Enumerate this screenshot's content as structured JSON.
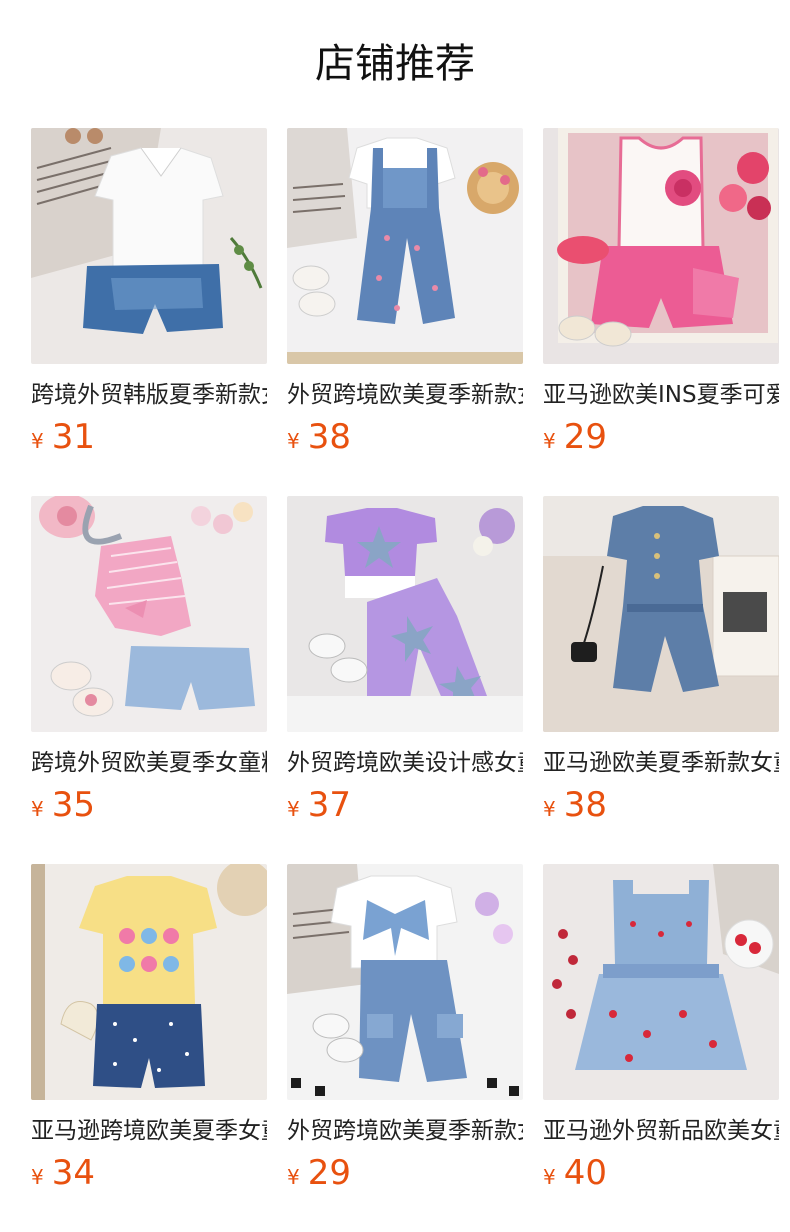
{
  "page": {
    "title": "店铺推荐"
  },
  "theme": {
    "price_color": "#e8510f",
    "text_color": "#222222"
  },
  "products": [
    {
      "name": "跨境外贸韩版夏季新款女童白色翻领短袖牛仔短裤套装",
      "currency": "¥",
      "price": "31",
      "image": "white-collar-top-denim-shorts"
    },
    {
      "name": "外贸跨境欧美夏季新款女童白色T恤牛仔背带裤套装",
      "currency": "¥",
      "price": "38",
      "image": "white-tee-denim-overalls"
    },
    {
      "name": "亚马逊欧美INS夏季可爱女童玫瑰背心粉色短裤套装",
      "currency": "¥",
      "price": "29",
      "image": "rose-tank-pink-shorts"
    },
    {
      "name": "跨境外贸欧美夏季女童粉色条纹斜肩上衣牛仔短裤套装",
      "currency": "¥",
      "price": "35",
      "image": "pink-striped-top-denim-shorts"
    },
    {
      "name": "外贸跨境欧美设计感女童星星紫色短袖长裤套装",
      "currency": "¥",
      "price": "37",
      "image": "purple-star-tee-pants"
    },
    {
      "name": "亚马逊欧美夏季新款女童牛仔短袖连体短裤",
      "currency": "¥",
      "price": "38",
      "image": "denim-romper"
    },
    {
      "name": "亚马逊跨境欧美夏季女童黄色花朵T恤牛仔短裤套装",
      "currency": "¥",
      "price": "34",
      "image": "yellow-flower-tee-denim-shorts"
    },
    {
      "name": "外贸跨境欧美夏季新款女童蝴蝶结T恤工装长裤套装",
      "currency": "¥",
      "price": "29",
      "image": "bow-tee-cargo-pants"
    },
    {
      "name": "亚马逊外贸新品欧美女童牛仔吊带上衣樱桃半身裙套装",
      "currency": "¥",
      "price": "40",
      "image": "denim-cherry-top-skirt"
    }
  ]
}
